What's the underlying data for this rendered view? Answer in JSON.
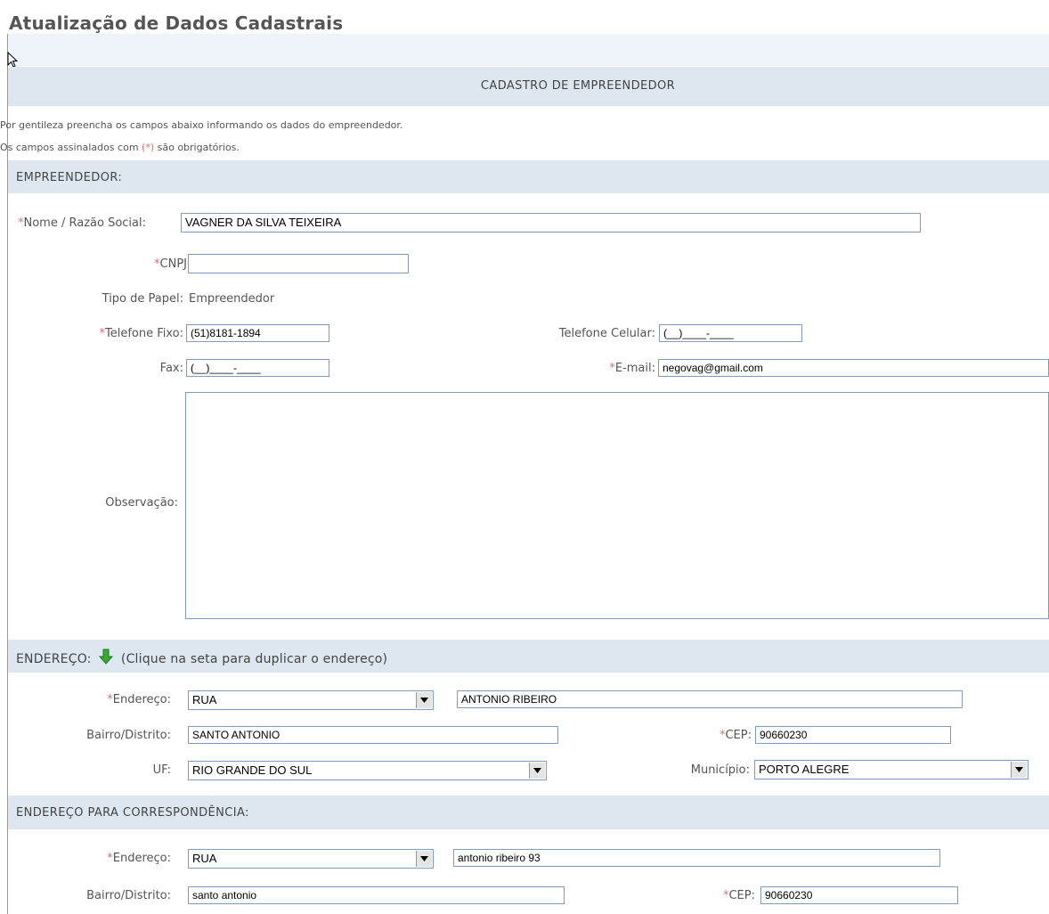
{
  "page": {
    "title": "Atualização de Dados Cadastrais",
    "form_title": "CADASTRO DE EMPREENDEDOR",
    "info_line1": "Por gentileza preencha os campos abaixo informando os dados do empreendedor.",
    "info_line2_prefix": "Os campos assinalados com ",
    "info_line2_mark": "(*)",
    "info_line2_suffix": "  são obrigatórios.",
    "required_mark": "*"
  },
  "empreendedor": {
    "section": "EMPREENDEDOR:",
    "nome_label": "Nome / Razão Social:",
    "nome_value": "VAGNER DA SILVA TEIXEIRA",
    "cnpj_label": "CNPJ",
    "cnpj_value": "",
    "tipo_label": "Tipo de Papel:",
    "tipo_value": "Empreendedor",
    "tel_fixo_label": "Telefone Fixo:",
    "tel_fixo_value": "(51)8181-1894",
    "tel_cel_label": "Telefone Celular:",
    "tel_cel_value": "(__)____-____",
    "fax_label": "Fax:",
    "fax_value": "(__)____-____",
    "email_label": "E-mail:",
    "email_value": "negovag@gmail.com",
    "obs_label": "Observação:",
    "obs_value": ""
  },
  "endereco": {
    "section": "ENDEREÇO:",
    "hint": "(Clique na seta para duplicar o endereço)",
    "end_label": "Endereço:",
    "tipo_select": "RUA",
    "logradouro": "ANTONIO RIBEIRO",
    "bairro_label": "Bairro/Distrito:",
    "bairro_value": "SANTO ANTONIO",
    "cep_label": "CEP:",
    "cep_value": "90660230",
    "uf_label": "UF:",
    "uf_select": "RIO GRANDE DO SUL",
    "municipio_label": "Município:",
    "municipio_select": "PORTO ALEGRE"
  },
  "correspondencia": {
    "section": "ENDEREÇO PARA CORRESPONDÊNCIA:",
    "end_label": "Endereço:",
    "tipo_select": "RUA",
    "logradouro": "antonio ribeiro 93",
    "bairro_label": "Bairro/Distrito:",
    "bairro_value": "santo antonio",
    "cep_label": "CEP:",
    "cep_value": "90660230"
  },
  "colors": {
    "section_band": "#dde7ef",
    "top_band": "#eef4fa",
    "required": "#e56a6a",
    "field_border": "#7f9db9",
    "arrow_green": "#3aa836"
  },
  "icons": {
    "duplicate_address": "green-down-arrow-icon",
    "select_dropdown": "triangle-down-icon",
    "mouse_cursor": "cursor-arrow-icon"
  }
}
